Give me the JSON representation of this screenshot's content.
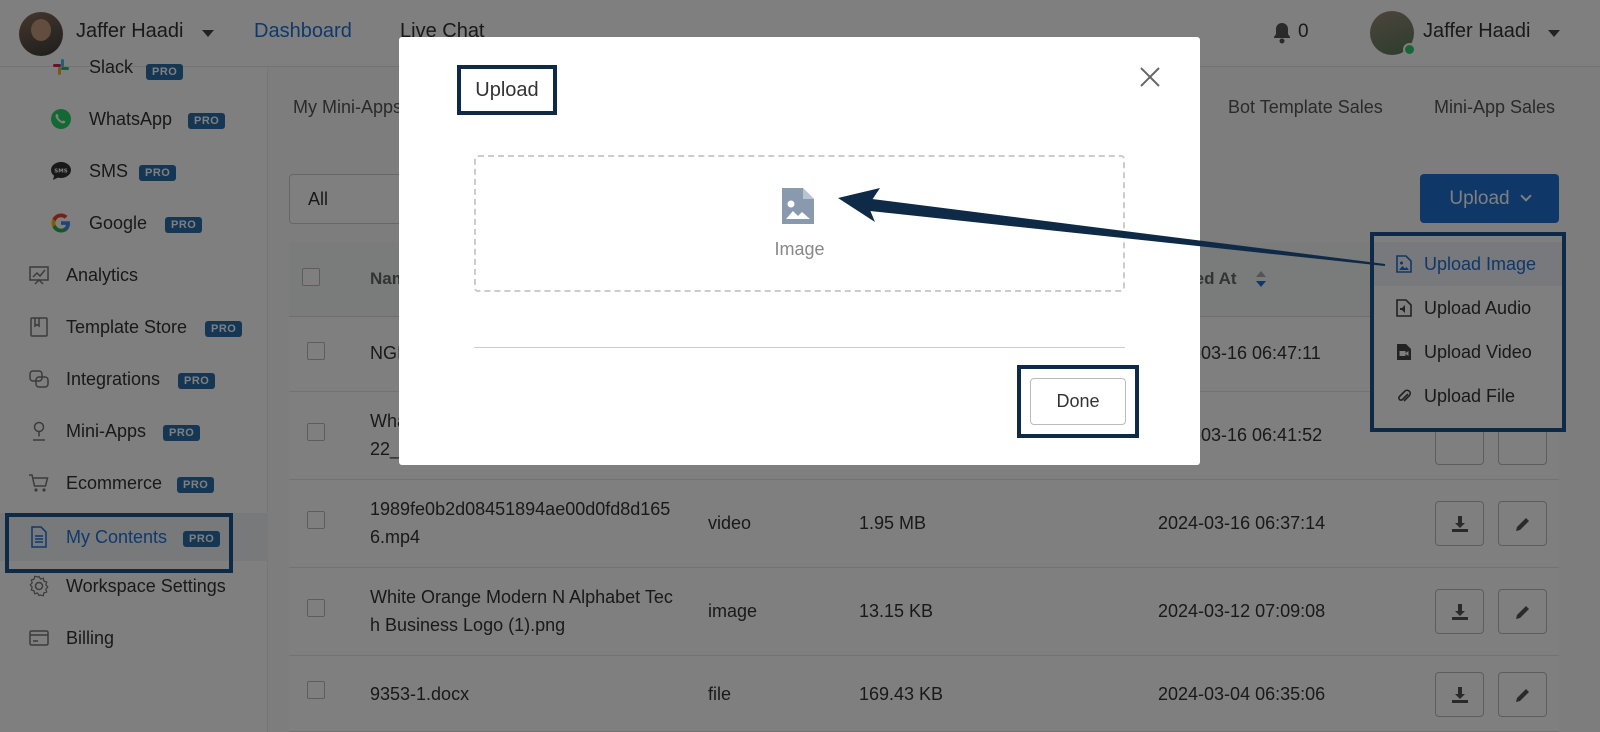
{
  "header": {
    "workspace_name": "Jaffer Haadi",
    "nav": [
      {
        "label": "Dashboard"
      },
      {
        "label": "Live Chat"
      }
    ],
    "notification_count": "0",
    "user_name": "Jaffer Haadi"
  },
  "sidebar": {
    "items": [
      {
        "label": "Slack",
        "pro": "PRO",
        "icon": "slack-icon"
      },
      {
        "label": "WhatsApp",
        "pro": "PRO",
        "icon": "whatsapp-icon"
      },
      {
        "label": "SMS",
        "pro": "PRO",
        "icon": "sms-icon"
      },
      {
        "label": "Google",
        "pro": "PRO",
        "icon": "google-icon"
      },
      {
        "label": "Analytics",
        "icon": "analytics-icon"
      },
      {
        "label": "Template Store",
        "pro": "PRO",
        "icon": "template-store-icon"
      },
      {
        "label": "Integrations",
        "pro": "PRO",
        "icon": "integrations-icon"
      },
      {
        "label": "Mini-Apps",
        "pro": "PRO",
        "icon": "mini-apps-icon"
      },
      {
        "label": "Ecommerce",
        "pro": "PRO",
        "icon": "cart-icon"
      },
      {
        "label": "My Contents",
        "pro": "PRO",
        "icon": "document-icon"
      },
      {
        "label": "Workspace Settings",
        "icon": "gear-icon"
      },
      {
        "label": "Billing",
        "icon": "billing-icon"
      }
    ]
  },
  "tabs": [
    {
      "label": "My Mini-Apps"
    },
    {
      "label": "Bot Template Sales"
    },
    {
      "label": "Mini-App Sales"
    }
  ],
  "filter": {
    "value": "All"
  },
  "upload_button": {
    "label": "Upload"
  },
  "upload_menu": {
    "items": [
      {
        "label": "Upload Image",
        "icon": "image-file-icon"
      },
      {
        "label": "Upload Audio",
        "icon": "audio-file-icon"
      },
      {
        "label": "Upload Video",
        "icon": "video-file-icon"
      },
      {
        "label": "Upload File",
        "icon": "paperclip-icon"
      }
    ]
  },
  "table": {
    "columns": {
      "name": "Nam",
      "created": "ted At"
    },
    "rows": [
      {
        "name": [
          "NGI"
        ],
        "type": "",
        "size": "",
        "created": "-03-16 06:47:11"
      },
      {
        "name": [
          "Wha",
          "22_"
        ],
        "type": "",
        "size": "",
        "created": "-03-16 06:41:52"
      },
      {
        "name": [
          "1989fe0b2d08451894ae00d0fd8d165",
          "6.mp4"
        ],
        "type": "video",
        "size": "1.95 MB",
        "created": "2024-03-16 06:37:14"
      },
      {
        "name": [
          "White Orange Modern N Alphabet Tec",
          "h Business Logo (1).png"
        ],
        "type": "image",
        "size": "13.15 KB",
        "created": "2024-03-12 07:09:08"
      },
      {
        "name": [
          "9353-1.docx"
        ],
        "type": "file",
        "size": "169.43 KB",
        "created": "2024-03-04 06:35:06"
      }
    ]
  },
  "modal": {
    "title": "Upload",
    "dropzone_label": "Image",
    "done_label": "Done"
  },
  "colors": {
    "accent": "#1e6fd0",
    "annotation": "#0f2a47",
    "pro_badge": "#2b6ea6"
  }
}
